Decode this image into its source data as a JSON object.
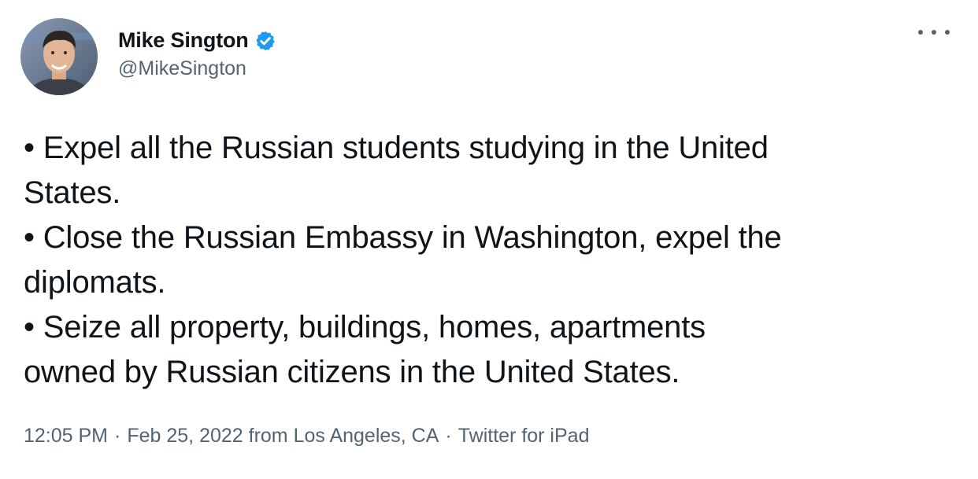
{
  "user": {
    "display_name": "Mike Sington",
    "handle": "@MikeSington",
    "verified_icon": "verified-badge-icon",
    "verified_color": "#1d9bf0"
  },
  "more_icon": "more-horizontal-icon",
  "tweet": {
    "lines": [
      "• Expel all the Russian students studying in the United",
      "States.",
      "• Close the Russian Embassy in Washington, expel the",
      "diplomats.",
      "• Seize all property, buildings, homes, apartments",
      "owned by Russian citizens in the United States."
    ]
  },
  "meta": {
    "time": "12:05 PM",
    "separator": "·",
    "date_location": "Feb 25, 2022 from Los Angeles, CA",
    "source": "Twitter for iPad"
  },
  "colors": {
    "text": "#0f1419",
    "secondary": "#536471",
    "accent": "#1d9bf0"
  }
}
